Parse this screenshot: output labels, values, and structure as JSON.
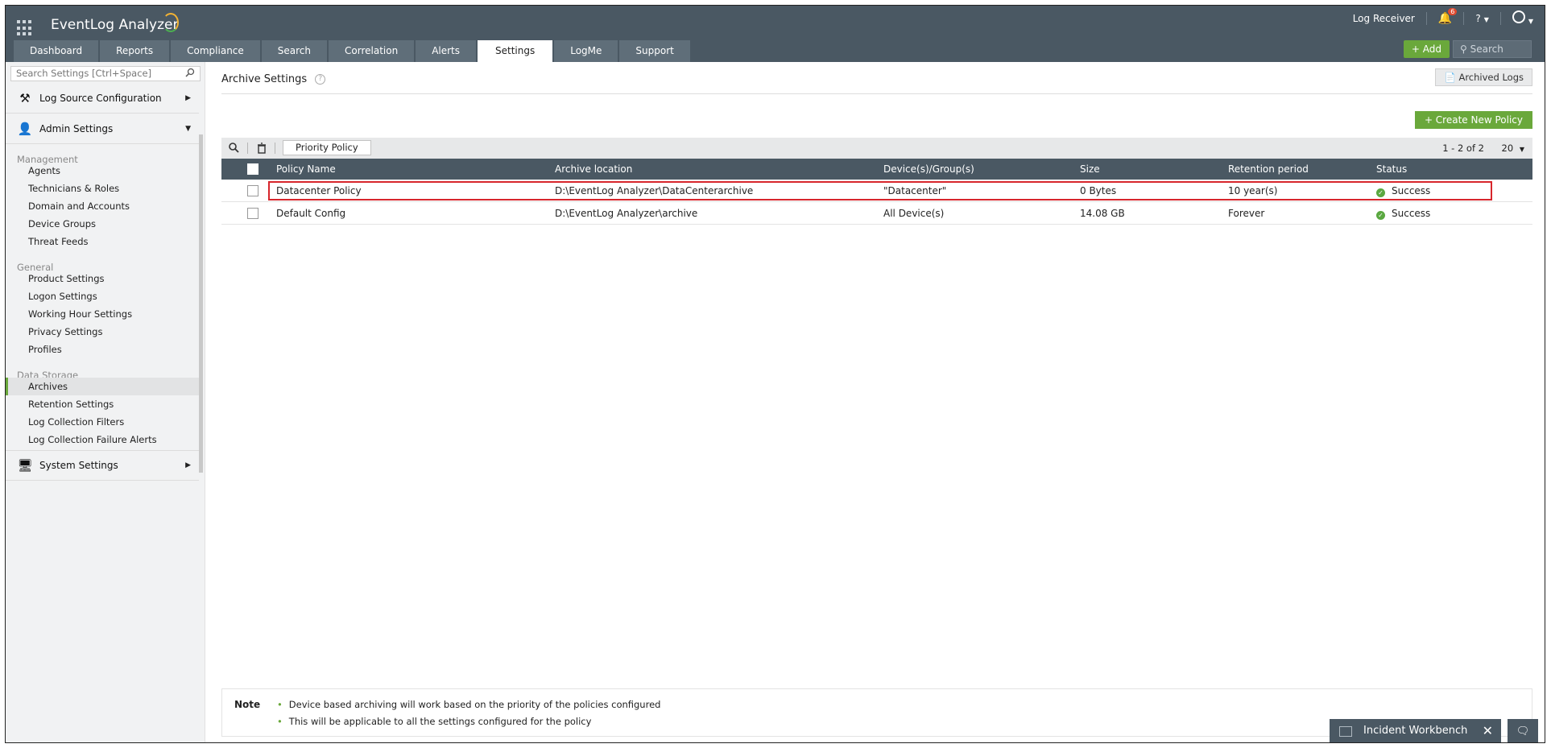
{
  "app": {
    "title": "EventLog Analyzer",
    "brand_arc_colors": [
      "#f2b233",
      "#4caf50"
    ]
  },
  "header": {
    "log_receiver": "Log Receiver",
    "notifications_count": "6",
    "help": "?",
    "add_button": "+ Add",
    "search_placeholder": "Search",
    "tabs": [
      {
        "label": "Dashboard"
      },
      {
        "label": "Reports"
      },
      {
        "label": "Compliance"
      },
      {
        "label": "Search"
      },
      {
        "label": "Correlation"
      },
      {
        "label": "Alerts"
      },
      {
        "label": "Settings",
        "active": true
      },
      {
        "label": "LogMe"
      },
      {
        "label": "Support"
      }
    ]
  },
  "sidebar": {
    "search_placeholder": "Search Settings [Ctrl+Space]",
    "groups": {
      "log_source": "Log Source Configuration",
      "admin": "Admin Settings",
      "system": "System Settings"
    },
    "sections": {
      "management": "Management",
      "general": "General",
      "data_storage": "Data Storage"
    },
    "management_items": [
      "Agents",
      "Technicians & Roles",
      "Domain and Accounts",
      "Device Groups",
      "Threat Feeds"
    ],
    "general_items": [
      "Product Settings",
      "Logon Settings",
      "Working Hour Settings",
      "Privacy Settings",
      "Profiles"
    ],
    "data_storage_items": [
      "Archives",
      "Retention Settings",
      "Log Collection Filters",
      "Log Collection Failure Alerts"
    ],
    "active_item": "Archives"
  },
  "main": {
    "page_title": "Archive Settings",
    "archived_logs_button": "Archived Logs",
    "create_button": "+ Create New Policy",
    "priority_button": "Priority Policy",
    "pager": "1 - 2 of 2",
    "per_page": "20",
    "columns": [
      "Policy Name",
      "Archive location",
      "Device(s)/Group(s)",
      "Size",
      "Retention period",
      "Status"
    ],
    "rows": [
      {
        "name": "Datacenter Policy",
        "location": "D:\\EventLog Analyzer\\DataCenterarchive",
        "devices": "\"Datacenter\"",
        "size": "0 Bytes",
        "retention": "10 year(s)",
        "status": "Success",
        "highlighted": true
      },
      {
        "name": "Default Config",
        "location": "D:\\EventLog Analyzer\\archive",
        "devices": "All Device(s)",
        "size": "14.08 GB",
        "retention": "Forever",
        "status": "Success",
        "highlighted": false
      }
    ],
    "note": {
      "label": "Note",
      "items": [
        "Device based archiving will work based on the priority of the policies configured",
        "This will be applicable to all the settings configured for the policy"
      ]
    }
  },
  "footer": {
    "workbench_label": "Incident Workbench"
  },
  "colors": {
    "header_bg": "#4a5863",
    "accent_green": "#6aa83b",
    "highlight_red": "#d7262c",
    "success": "#5aa840"
  }
}
